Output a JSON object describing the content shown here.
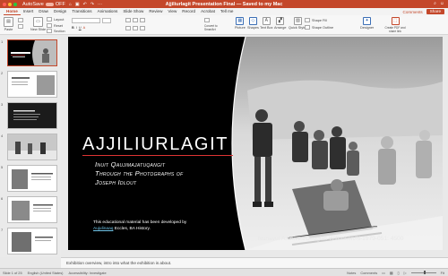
{
  "titlebar": {
    "autosave_label": "AutoSave",
    "autosave_state": "OFF",
    "doc_title": "Ajjiliurlagit Presentation Final — Saved to my Mac",
    "colors": {
      "accent": "#c4472a"
    }
  },
  "tabs": {
    "items": [
      "Home",
      "Insert",
      "Draw",
      "Design",
      "Transitions",
      "Animations",
      "Slide Show",
      "Review",
      "View",
      "Record",
      "Acrobat",
      "Tell me"
    ],
    "active": "Home",
    "comments_label": "Comments",
    "share_label": "Share"
  },
  "ribbon": {
    "paste": "Paste",
    "new_slide": "New Slide",
    "layout": "Layout",
    "reset": "Reset",
    "section": "Section",
    "convert": "Convert to SmartArt",
    "picture": "Picture",
    "shapes": "Shapes",
    "text_box": "Text Box",
    "arrange": "Arrange",
    "quick_styles": "Quick Styles",
    "shape_fill": "Shape Fill",
    "shape_outline": "Shape Outline",
    "designer": "Designer",
    "create_pdf": "Create PDF and share link"
  },
  "slide": {
    "title": "AJJILIURLAGIT",
    "subtitle_lines": [
      "Inuit Qaujimajatuqangit",
      "Through the Photographs of",
      "Joseph Idlout"
    ],
    "note_prefix": "This educational material has been developed by",
    "note_link": "Aujulinaaq",
    "note_suffix": "Eccles, BA History.",
    "credit": "Nunavut Archives/Douglas Wilkinson/N-1979-051: 4500"
  },
  "notes": {
    "text": "Exhibition overview, intro into what the exhibition is about."
  },
  "status": {
    "slide_count": "Slide 1 of 25",
    "language": "English (United States)",
    "accessibility": "Accessibility: Investigate",
    "notes_label": "Notes",
    "comments_label": "Comments",
    "zoom": "Fit"
  },
  "thumbnails": [
    {
      "num": "1",
      "kind": "title"
    },
    {
      "num": "2",
      "kind": "light"
    },
    {
      "num": "3",
      "kind": "dark"
    },
    {
      "num": "4",
      "kind": "photo"
    },
    {
      "num": "5",
      "kind": "light"
    },
    {
      "num": "6",
      "kind": "light"
    },
    {
      "num": "7",
      "kind": "light"
    }
  ]
}
